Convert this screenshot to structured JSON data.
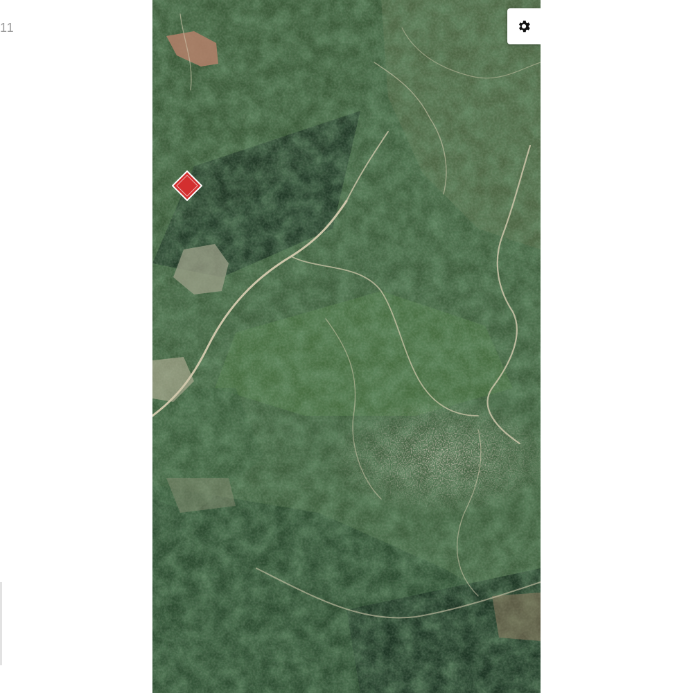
{
  "page": {
    "corner_text": "11"
  },
  "map": {
    "type": "satellite",
    "settings_icon": "gear-icon",
    "marker": {
      "icon": "location-marker-icon",
      "color": "#d32f2f",
      "label": ""
    }
  }
}
